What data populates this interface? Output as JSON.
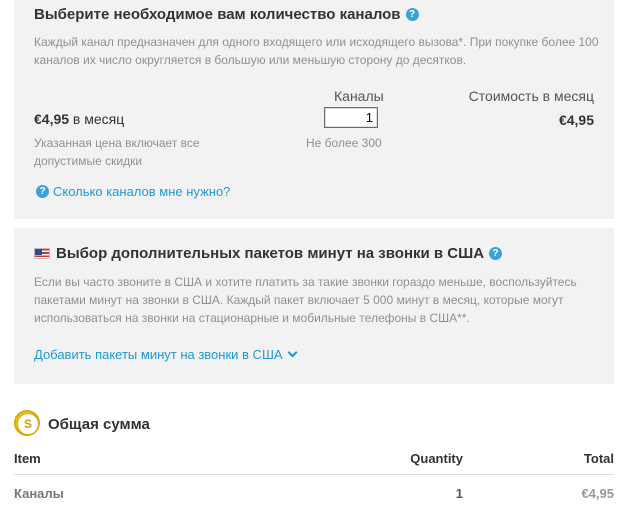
{
  "channels_panel": {
    "title": "Выберите необходимое вам количество каналов",
    "help_icon": "question-circle-icon",
    "description": "Каждый канал предназначен для одного входящего или исходящего вызова*. При покупке более 100 каналов их число округляется в большую или меньшую сторону до десятков.",
    "price": "€4,95",
    "price_suffix": " в месяц",
    "price_note": "Указанная цена включает все допустимые скидки",
    "channels_label": "Каналы",
    "channels_value": "1",
    "channels_limit": "Не более 300",
    "monthly_label": "Стоимость в месяц",
    "monthly_value": "€4,95",
    "help_link": "Сколько каналов мне нужно?"
  },
  "packages_panel": {
    "flag_icon": "us-flag-icon",
    "title": "Выбор дополнительных пакетов минут на звонки в США",
    "description": "Если вы часто звоните в США и хотите платить за такие звонки гораздо меньше, воспользуйтесь пакетами минут на звонки в США. Каждый пакет включает 5 000 минут в месяц, которые могут использоваться на звонки на стационарные и мобильные телефоны в США**.",
    "add_link": "Добавить пакеты минут на звонки в США"
  },
  "total": {
    "icon": "coin-icon",
    "title": "Общая сумма",
    "headers": {
      "item": "Item",
      "quantity": "Quantity",
      "total": "Total"
    },
    "rows": [
      {
        "item": "Каналы",
        "quantity": "1",
        "total": "€4,95"
      }
    ]
  },
  "colors": {
    "panel_bg": "#f2f2f2",
    "link": "#1f9ad6",
    "muted": "#909090"
  }
}
